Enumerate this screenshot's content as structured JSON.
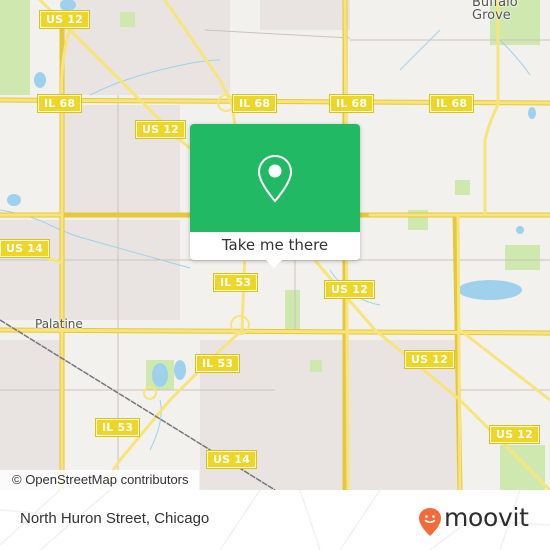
{
  "map": {
    "colors": {
      "land": "#f2f1ee",
      "residential": "#e9e4e1",
      "park": "#cfe8b0",
      "water": "#9fd1ec",
      "highway": "#f5dc55",
      "highway_edge": "#e6c93b",
      "shield_bg": "#eed628",
      "railway": "#777777"
    },
    "route_shields": [
      {
        "id": "us12-a",
        "label": "US 12"
      },
      {
        "id": "il68-a",
        "label": "IL 68"
      },
      {
        "id": "il68-b",
        "label": "IL 68"
      },
      {
        "id": "il68-c",
        "label": "IL 68"
      },
      {
        "id": "il68-d",
        "label": "IL 68"
      },
      {
        "id": "us12-b",
        "label": "US 12"
      },
      {
        "id": "us14-a",
        "label": "US 14"
      },
      {
        "id": "il53-a",
        "label": "IL 53"
      },
      {
        "id": "us12-c",
        "label": "US 12"
      },
      {
        "id": "il53-b",
        "label": "IL 53"
      },
      {
        "id": "us12-d",
        "label": "US 12"
      },
      {
        "id": "il53-c",
        "label": "IL 53"
      },
      {
        "id": "us12-e",
        "label": "US 12"
      },
      {
        "id": "us14-b",
        "label": "US 14"
      }
    ],
    "places": [
      {
        "name": "Palatine"
      },
      {
        "name": "Buffalo Grove",
        "line1": "Buffalo",
        "line2": "Grove"
      }
    ],
    "attribution": "© OpenStreetMap contributors"
  },
  "popup": {
    "icon": "map-pin-icon",
    "button_label": "Take me there",
    "color": "#22b965"
  },
  "footer": {
    "title": "North Huron Street, Chicago",
    "brand": "moovit",
    "brand_color": "#f26b3a"
  }
}
